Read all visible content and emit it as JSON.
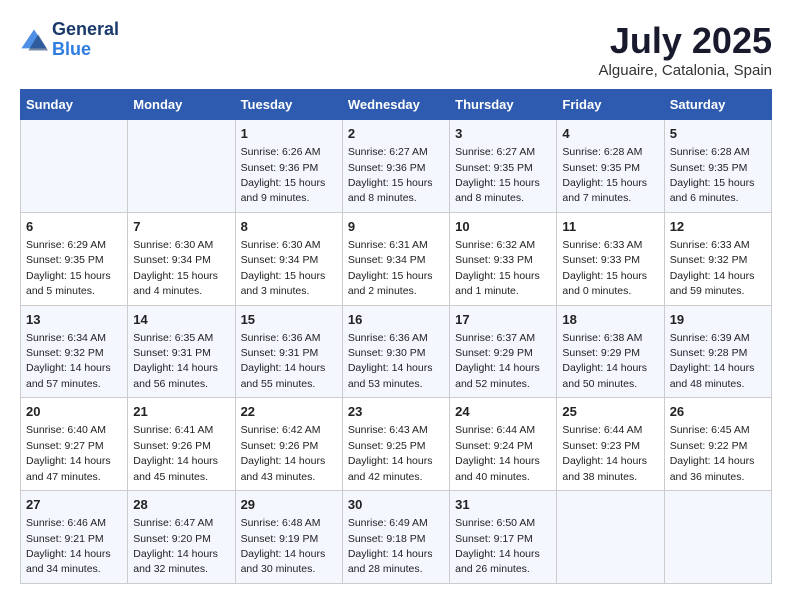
{
  "logo": {
    "general": "General",
    "blue": "Blue"
  },
  "title": "July 2025",
  "location": "Alguaire, Catalonia, Spain",
  "days_of_week": [
    "Sunday",
    "Monday",
    "Tuesday",
    "Wednesday",
    "Thursday",
    "Friday",
    "Saturday"
  ],
  "weeks": [
    [
      {
        "day": "",
        "info": ""
      },
      {
        "day": "",
        "info": ""
      },
      {
        "day": "1",
        "info": "Sunrise: 6:26 AM\nSunset: 9:36 PM\nDaylight: 15 hours and 9 minutes."
      },
      {
        "day": "2",
        "info": "Sunrise: 6:27 AM\nSunset: 9:36 PM\nDaylight: 15 hours and 8 minutes."
      },
      {
        "day": "3",
        "info": "Sunrise: 6:27 AM\nSunset: 9:35 PM\nDaylight: 15 hours and 8 minutes."
      },
      {
        "day": "4",
        "info": "Sunrise: 6:28 AM\nSunset: 9:35 PM\nDaylight: 15 hours and 7 minutes."
      },
      {
        "day": "5",
        "info": "Sunrise: 6:28 AM\nSunset: 9:35 PM\nDaylight: 15 hours and 6 minutes."
      }
    ],
    [
      {
        "day": "6",
        "info": "Sunrise: 6:29 AM\nSunset: 9:35 PM\nDaylight: 15 hours and 5 minutes."
      },
      {
        "day": "7",
        "info": "Sunrise: 6:30 AM\nSunset: 9:34 PM\nDaylight: 15 hours and 4 minutes."
      },
      {
        "day": "8",
        "info": "Sunrise: 6:30 AM\nSunset: 9:34 PM\nDaylight: 15 hours and 3 minutes."
      },
      {
        "day": "9",
        "info": "Sunrise: 6:31 AM\nSunset: 9:34 PM\nDaylight: 15 hours and 2 minutes."
      },
      {
        "day": "10",
        "info": "Sunrise: 6:32 AM\nSunset: 9:33 PM\nDaylight: 15 hours and 1 minute."
      },
      {
        "day": "11",
        "info": "Sunrise: 6:33 AM\nSunset: 9:33 PM\nDaylight: 15 hours and 0 minutes."
      },
      {
        "day": "12",
        "info": "Sunrise: 6:33 AM\nSunset: 9:32 PM\nDaylight: 14 hours and 59 minutes."
      }
    ],
    [
      {
        "day": "13",
        "info": "Sunrise: 6:34 AM\nSunset: 9:32 PM\nDaylight: 14 hours and 57 minutes."
      },
      {
        "day": "14",
        "info": "Sunrise: 6:35 AM\nSunset: 9:31 PM\nDaylight: 14 hours and 56 minutes."
      },
      {
        "day": "15",
        "info": "Sunrise: 6:36 AM\nSunset: 9:31 PM\nDaylight: 14 hours and 55 minutes."
      },
      {
        "day": "16",
        "info": "Sunrise: 6:36 AM\nSunset: 9:30 PM\nDaylight: 14 hours and 53 minutes."
      },
      {
        "day": "17",
        "info": "Sunrise: 6:37 AM\nSunset: 9:29 PM\nDaylight: 14 hours and 52 minutes."
      },
      {
        "day": "18",
        "info": "Sunrise: 6:38 AM\nSunset: 9:29 PM\nDaylight: 14 hours and 50 minutes."
      },
      {
        "day": "19",
        "info": "Sunrise: 6:39 AM\nSunset: 9:28 PM\nDaylight: 14 hours and 48 minutes."
      }
    ],
    [
      {
        "day": "20",
        "info": "Sunrise: 6:40 AM\nSunset: 9:27 PM\nDaylight: 14 hours and 47 minutes."
      },
      {
        "day": "21",
        "info": "Sunrise: 6:41 AM\nSunset: 9:26 PM\nDaylight: 14 hours and 45 minutes."
      },
      {
        "day": "22",
        "info": "Sunrise: 6:42 AM\nSunset: 9:26 PM\nDaylight: 14 hours and 43 minutes."
      },
      {
        "day": "23",
        "info": "Sunrise: 6:43 AM\nSunset: 9:25 PM\nDaylight: 14 hours and 42 minutes."
      },
      {
        "day": "24",
        "info": "Sunrise: 6:44 AM\nSunset: 9:24 PM\nDaylight: 14 hours and 40 minutes."
      },
      {
        "day": "25",
        "info": "Sunrise: 6:44 AM\nSunset: 9:23 PM\nDaylight: 14 hours and 38 minutes."
      },
      {
        "day": "26",
        "info": "Sunrise: 6:45 AM\nSunset: 9:22 PM\nDaylight: 14 hours and 36 minutes."
      }
    ],
    [
      {
        "day": "27",
        "info": "Sunrise: 6:46 AM\nSunset: 9:21 PM\nDaylight: 14 hours and 34 minutes."
      },
      {
        "day": "28",
        "info": "Sunrise: 6:47 AM\nSunset: 9:20 PM\nDaylight: 14 hours and 32 minutes."
      },
      {
        "day": "29",
        "info": "Sunrise: 6:48 AM\nSunset: 9:19 PM\nDaylight: 14 hours and 30 minutes."
      },
      {
        "day": "30",
        "info": "Sunrise: 6:49 AM\nSunset: 9:18 PM\nDaylight: 14 hours and 28 minutes."
      },
      {
        "day": "31",
        "info": "Sunrise: 6:50 AM\nSunset: 9:17 PM\nDaylight: 14 hours and 26 minutes."
      },
      {
        "day": "",
        "info": ""
      },
      {
        "day": "",
        "info": ""
      }
    ]
  ]
}
